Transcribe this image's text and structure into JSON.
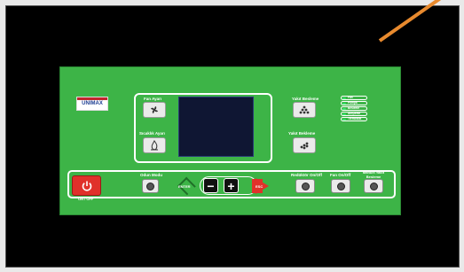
{
  "panel": {
    "logo": "UNIMAX",
    "display": {
      "fan_label": "Fan Ayarı",
      "heat_label": "Sıcaklık Ayarı",
      "fuel_load_label": "Yakıt Besleme",
      "fuel_wait_label": "Yakıt Bekleme"
    },
    "indicators": [
      {
        "label": "Fan"
      },
      {
        "label": "Pompa"
      },
      {
        "label": "Besleme"
      },
      {
        "label": "Ateşleme"
      },
      {
        "label": "Termostat"
      }
    ],
    "controls": {
      "power_label": "ON / OFF",
      "wood_mode_label": "Odun Modu",
      "enter_label": "ENTER",
      "minus_symbol": "−",
      "plus_symbol": "+",
      "esc_label": "ESC",
      "feeder_label": "Redüktör On/Off",
      "fan_onoff_label": "Fan On/Off",
      "manual_fuel_label": "Manuel Yakıt Besleme"
    }
  }
}
